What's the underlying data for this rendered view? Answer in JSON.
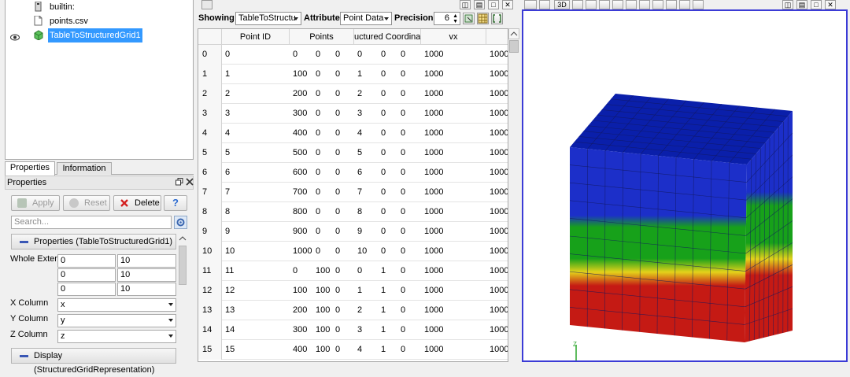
{
  "pipeline": {
    "items": [
      {
        "label": "builtin:",
        "icon": "server-icon",
        "selected": false,
        "visible": false
      },
      {
        "label": "points.csv",
        "icon": "file-icon",
        "selected": false,
        "visible": false
      },
      {
        "label": "TableToStructuredGrid1",
        "icon": "structured-grid-icon",
        "selected": true,
        "visible": true
      }
    ]
  },
  "tabs": [
    "Properties",
    "Information"
  ],
  "properties_panel": {
    "title": "Properties",
    "apply_label": "Apply",
    "reset_label": "Reset",
    "delete_label": "Delete",
    "help_label": "?",
    "search_placeholder": "Search...",
    "section_properties": "Properties (TableToStructuredGrid1)",
    "whole_extent_label": "Whole Extent",
    "whole_extent": [
      [
        "0",
        "10"
      ],
      [
        "0",
        "10"
      ],
      [
        "0",
        "10"
      ]
    ],
    "x_column_label": "X Column",
    "x_column": "x",
    "y_column_label": "Y Column",
    "y_column": "y",
    "z_column_label": "Z Column",
    "z_column": "z",
    "section_display": "Display (StructuredGridRepresentation)"
  },
  "spreadsheet": {
    "showing_label": "Showing",
    "showing_value": "TableToStructu",
    "attribute_label": "Attribute:",
    "attribute_value": "Point Data",
    "precision_label": "Precision:",
    "precision_value": "6",
    "columns": [
      "",
      "Point ID",
      "Points",
      "",
      "",
      "uctured Coordina",
      "",
      "",
      "vx",
      ""
    ],
    "rows": [
      [
        "0",
        "0",
        "0",
        "0",
        "0",
        "0",
        "0",
        "0",
        "1000",
        "1000"
      ],
      [
        "1",
        "1",
        "100",
        "0",
        "0",
        "1",
        "0",
        "0",
        "1000",
        "1000"
      ],
      [
        "2",
        "2",
        "200",
        "0",
        "0",
        "2",
        "0",
        "0",
        "1000",
        "1000"
      ],
      [
        "3",
        "3",
        "300",
        "0",
        "0",
        "3",
        "0",
        "0",
        "1000",
        "1000"
      ],
      [
        "4",
        "4",
        "400",
        "0",
        "0",
        "4",
        "0",
        "0",
        "1000",
        "1000"
      ],
      [
        "5",
        "5",
        "500",
        "0",
        "0",
        "5",
        "0",
        "0",
        "1000",
        "1000"
      ],
      [
        "6",
        "6",
        "600",
        "0",
        "0",
        "6",
        "0",
        "0",
        "1000",
        "1000"
      ],
      [
        "7",
        "7",
        "700",
        "0",
        "0",
        "7",
        "0",
        "0",
        "1000",
        "1000"
      ],
      [
        "8",
        "8",
        "800",
        "0",
        "0",
        "8",
        "0",
        "0",
        "1000",
        "1000"
      ],
      [
        "9",
        "9",
        "900",
        "0",
        "0",
        "9",
        "0",
        "0",
        "1000",
        "1000"
      ],
      [
        "10",
        "10",
        "1000",
        "0",
        "0",
        "10",
        "0",
        "0",
        "1000",
        "1000"
      ],
      [
        "11",
        "11",
        "0",
        "100",
        "0",
        "0",
        "1",
        "0",
        "1000",
        "1000"
      ],
      [
        "12",
        "12",
        "100",
        "100",
        "0",
        "1",
        "1",
        "0",
        "1000",
        "1000"
      ],
      [
        "13",
        "13",
        "200",
        "100",
        "0",
        "2",
        "1",
        "0",
        "1000",
        "1000"
      ],
      [
        "14",
        "14",
        "300",
        "100",
        "0",
        "3",
        "1",
        "0",
        "1000",
        "1000"
      ],
      [
        "15",
        "15",
        "400",
        "100",
        "0",
        "4",
        "1",
        "0",
        "1000",
        "1000"
      ]
    ]
  },
  "render_view": {
    "mode_label": "3D",
    "axis_label": "Z",
    "colors": {
      "top": "#0a1faa",
      "blue": "#1c2fc9",
      "green": "#17a11a",
      "yellow": "#e4d21a",
      "red": "#c51a14",
      "grid_line": "#12185e"
    }
  }
}
